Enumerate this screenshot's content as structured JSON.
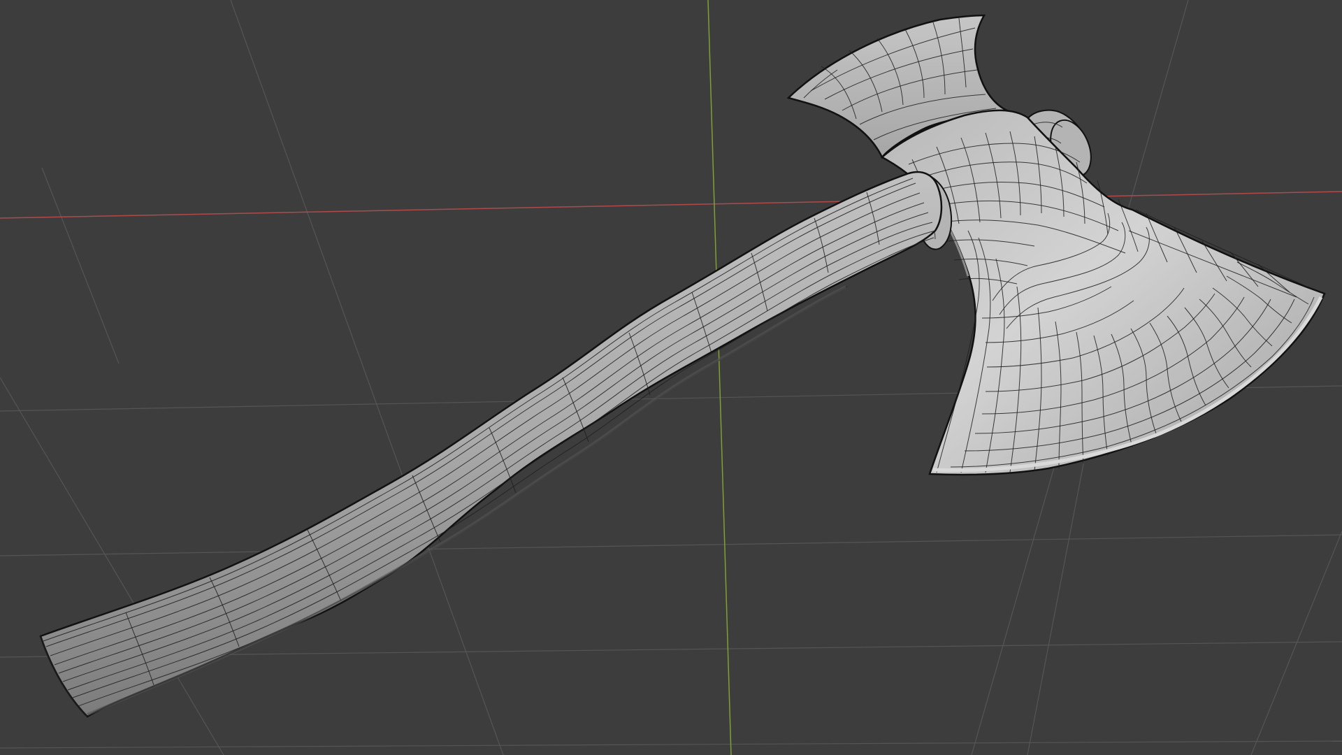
{
  "viewport": {
    "background_color": "#3d3d3d",
    "grid_color": "#555555",
    "x_axis_color": "#b04a4a",
    "y_axis_color": "#7fa032"
  },
  "mesh": {
    "object": "axe",
    "display": "wireframe-on-solid",
    "surface_color": "#b4b4b4",
    "surface_highlight_color": "#d0d0d0",
    "wire_color": "#1e1e1e",
    "outline_color": "#111111"
  }
}
